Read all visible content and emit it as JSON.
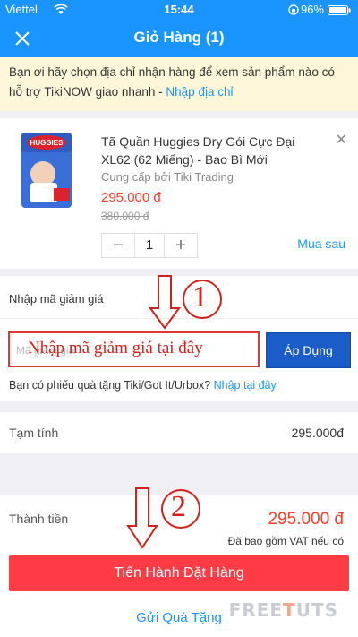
{
  "status_bar": {
    "carrier": "Viettel",
    "time": "15:44",
    "battery": "96%"
  },
  "nav": {
    "title": "Giỏ Hàng (1)",
    "close_icon": "close-icon"
  },
  "notice": {
    "text": "Bạn ơi hãy chọn địa chỉ nhận hàng để xem sản phẩm nào có hỗ trợ TikiNOW giao nhanh - ",
    "link": "Nhập địa chỉ"
  },
  "product": {
    "name": "Tã Quần Huggies Dry Gói Cực Đại XL62 (62 Miếng) - Bao Bì Mới",
    "seller": "Cung cấp bởi Tiki Trading",
    "price": "295.000 đ",
    "old_price": "380.000 đ",
    "quantity": "1",
    "minus": "−",
    "plus": "+",
    "save_later": "Mua sau",
    "remove": "✕",
    "brand": "HUGGIES"
  },
  "coupon": {
    "header": "Nhập mã giảm giá",
    "placeholder": "Mã giảm giá",
    "annotation_text": "Nhập mã giảm giá tại đây",
    "apply_label": "Áp Dụng",
    "gift_question": "Bạn có phiếu quà tặng Tiki/Got It/Urbox? ",
    "gift_link": "Nhập tại đây"
  },
  "summary": {
    "subtotal_label": "Tạm tính",
    "subtotal_value": "295.000đ",
    "total_label": "Thành tiền",
    "total_value": "295.000 đ",
    "vat_note": "Đã bao gồm VAT nếu có"
  },
  "actions": {
    "order_label": "Tiến Hành Đặt Hàng",
    "gift_label": "Gửi Quà Tặng"
  },
  "annotations": {
    "step1": "1",
    "step2": "2"
  },
  "watermark": {
    "part1": "FREE",
    "accent": "T",
    "part2": "UTS"
  },
  "colors": {
    "primary": "#1a94ff",
    "price": "#ff3b27",
    "order_button": "#ff3b45",
    "apply_button": "#1a5cc8",
    "annotation": "#d0221b"
  }
}
